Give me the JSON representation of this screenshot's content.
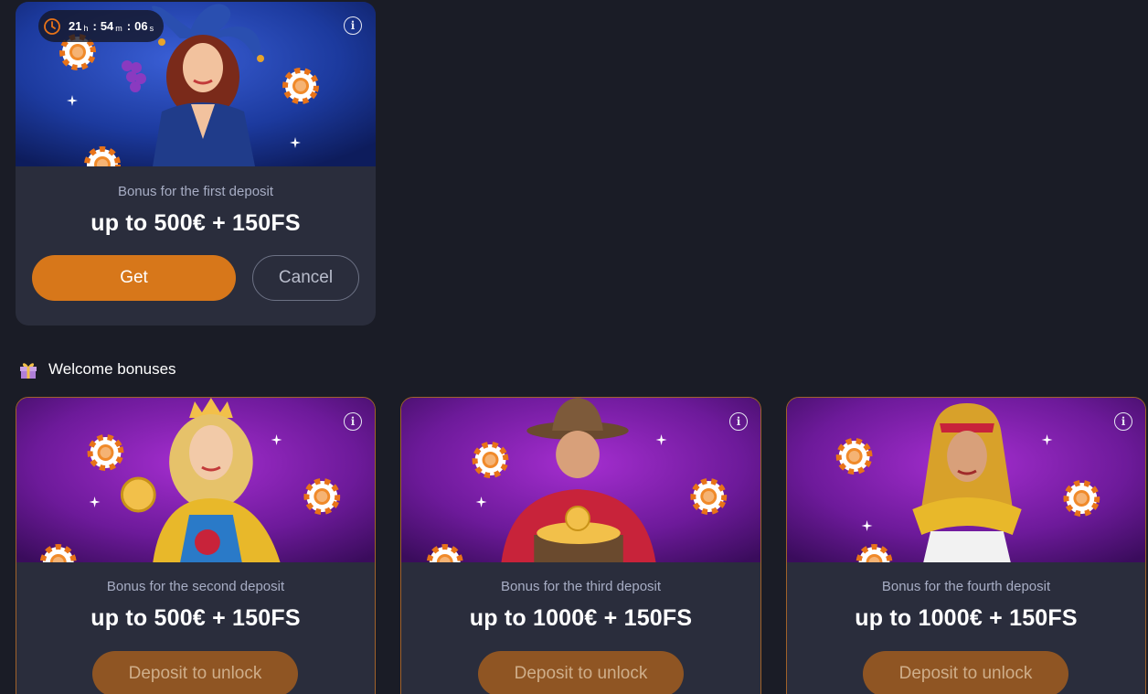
{
  "active_bonus": {
    "timer": {
      "hours": "21",
      "h_unit": "h",
      "minutes": "54",
      "m_unit": "m",
      "seconds": "06",
      "s_unit": "s"
    },
    "subtitle": "Bonus for the first deposit",
    "amount": "up to 500€ + 150FS",
    "get_label": "Get",
    "cancel_label": "Cancel"
  },
  "section": {
    "title": "Welcome bonuses"
  },
  "welcome_bonuses": [
    {
      "subtitle": "Bonus for the second deposit",
      "amount": "up to 500€ + 150FS",
      "button_label": "Deposit to unlock"
    },
    {
      "subtitle": "Bonus for the third deposit",
      "amount": "up to 1000€ + 150FS",
      "button_label": "Deposit to unlock"
    },
    {
      "subtitle": "Bonus for the fourth deposit",
      "amount": "up to 1000€ + 150FS",
      "button_label": "Deposit to unlock"
    }
  ],
  "colors": {
    "background": "#1a1c26",
    "card": "#2a2d3c",
    "primary_button": "#d7771a",
    "locked_button": "#8f5523",
    "locked_border": "#a0622a"
  }
}
